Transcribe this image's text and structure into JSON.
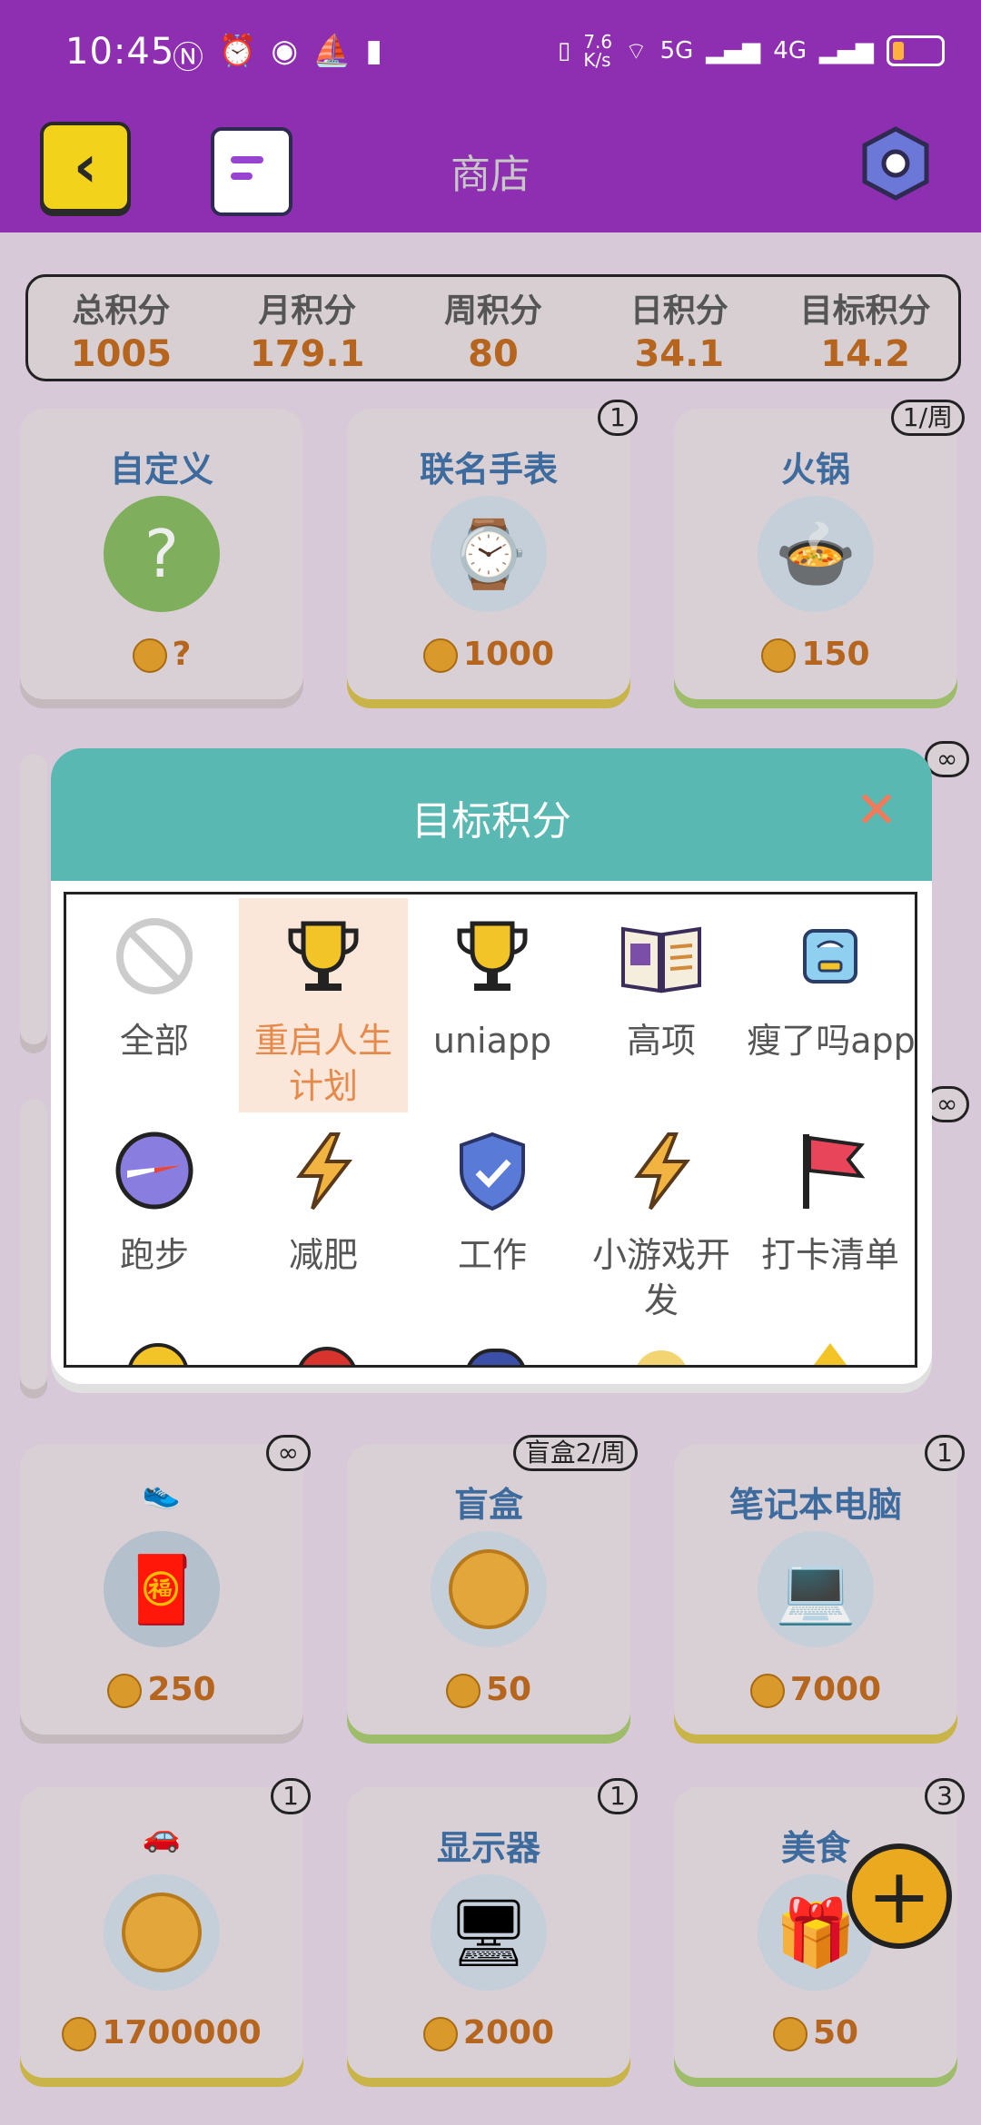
{
  "status_bar": {
    "time": "10:45",
    "net_speed": "7.6\nK/s",
    "network": "5G",
    "network2": "4G"
  },
  "app_bar": {
    "title": "商店"
  },
  "stats": [
    {
      "label": "总积分",
      "value": "1005"
    },
    {
      "label": "月积分",
      "value": "179.1"
    },
    {
      "label": "周积分",
      "value": "80"
    },
    {
      "label": "日积分",
      "value": "34.1"
    },
    {
      "label": "目标积分",
      "value": "14.2"
    }
  ],
  "shop_items": [
    {
      "title": "自定义",
      "icon": "question-icon",
      "price": "?",
      "badge": ""
    },
    {
      "title": "联名手表",
      "icon": "watch-icon",
      "price": "1000",
      "badge": "1"
    },
    {
      "title": "火锅",
      "icon": "hotpot-icon",
      "price": "150",
      "badge": "1/周"
    },
    {
      "title": "",
      "icon": "shoe-icon",
      "price": "250",
      "badge": "∞"
    },
    {
      "title": "盲盒",
      "icon": "coin-icon",
      "price": "50",
      "badge": "盲盒2/周"
    },
    {
      "title": "笔记本电脑",
      "icon": "laptop-icon",
      "price": "7000",
      "badge": "1"
    },
    {
      "title": "",
      "icon": "car-icon",
      "price": "1700000",
      "badge": "1"
    },
    {
      "title": "显示器",
      "icon": "monitor-icon",
      "price": "2000",
      "badge": "1"
    },
    {
      "title": "美食",
      "icon": "gift-icon",
      "price": "50",
      "badge": "3"
    }
  ],
  "side_badges": [
    "∞",
    "∞"
  ],
  "modal": {
    "title": "目标积分",
    "items": [
      {
        "label": "全部",
        "icon": "no-entry-icon",
        "selected": false
      },
      {
        "label": "重启人生计划",
        "icon": "trophy-icon",
        "selected": true
      },
      {
        "label": "uniapp",
        "icon": "trophy-icon",
        "selected": false
      },
      {
        "label": "高项",
        "icon": "book-icon",
        "selected": false
      },
      {
        "label": "瘦了吗app",
        "icon": "scale-icon",
        "selected": false
      },
      {
        "label": "跑步",
        "icon": "compass-icon",
        "selected": false
      },
      {
        "label": "减肥",
        "icon": "lightning-icon",
        "selected": false
      },
      {
        "label": "工作",
        "icon": "shield-icon",
        "selected": false
      },
      {
        "label": "小游戏开发",
        "icon": "lightning-icon",
        "selected": false
      },
      {
        "label": "打卡清单",
        "icon": "flag-icon",
        "selected": false
      }
    ]
  },
  "colors": {
    "header": "#8e2fb1",
    "modal_header": "#5ab8b2",
    "accent_orange": "#e58a4a",
    "price": "#b5651d"
  }
}
